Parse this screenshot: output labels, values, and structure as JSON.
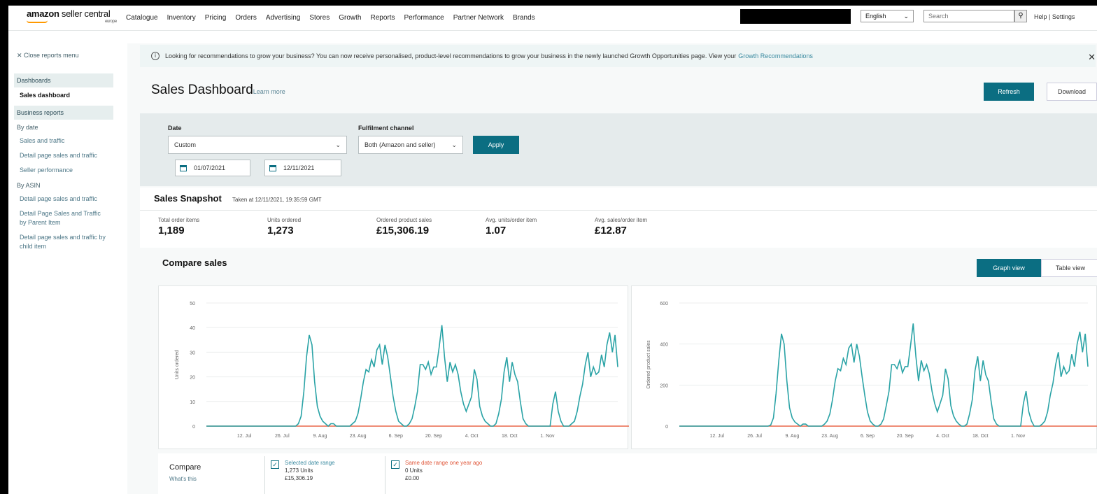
{
  "logo": {
    "brand": "amazon",
    "product": "seller central",
    "region": "europe"
  },
  "nav": [
    "Catalogue",
    "Inventory",
    "Pricing",
    "Orders",
    "Advertising",
    "Stores",
    "Growth",
    "Reports",
    "Performance",
    "Partner Network",
    "Brands"
  ],
  "language": {
    "selected": "English"
  },
  "search": {
    "placeholder": "Search"
  },
  "help_settings": "Help | Settings",
  "sidebar": {
    "close_label": "Close reports menu",
    "dashboards_header": "Dashboards",
    "active_item": "Sales dashboard",
    "business_header": "Business reports",
    "by_date_label": "By date",
    "by_date_items": [
      "Sales and traffic",
      "Detail page sales and traffic",
      "Seller performance"
    ],
    "by_asin_label": "By ASIN",
    "by_asin_items": [
      "Detail page sales and traffic",
      "Detail Page Sales and Traffic by Parent Item",
      "Detail page sales and traffic by child item"
    ]
  },
  "banner": {
    "text": "Looking for recommendations to grow your business? You can now receive personalised, product-level recommendations to grow your business in the newly launched Growth Opportunities page. View your",
    "link": "Growth Recommendations"
  },
  "page": {
    "title": "Sales Dashboard",
    "learn_more": "Learn more",
    "refresh_label": "Refresh",
    "download_label": "Download"
  },
  "filters": {
    "date_label": "Date",
    "date_value": "Custom",
    "start_date": "01/07/2021",
    "end_date": "12/11/2021",
    "channel_label": "Fulfilment channel",
    "channel_value": "Both (Amazon and seller)",
    "apply_label": "Apply"
  },
  "snapshot": {
    "title": "Sales Snapshot",
    "taken": "Taken at 12/11/2021, 19:35:59 GMT",
    "metrics": [
      {
        "label": "Total order items",
        "value": "1,189"
      },
      {
        "label": "Units ordered",
        "value": "1,273"
      },
      {
        "label": "Ordered product sales",
        "value": "£15,306.19"
      },
      {
        "label": "Avg. units/order item",
        "value": "1.07"
      },
      {
        "label": "Avg. sales/order item",
        "value": "£12.87"
      }
    ]
  },
  "compare": {
    "title": "Compare sales",
    "graph_view_label": "Graph view",
    "table_view_label": "Table view",
    "compare_label": "Compare",
    "whats_this": "What's this",
    "legend": [
      {
        "title": "Selected date range",
        "line1": "1,273 Units",
        "line2": "£15,306.19"
      },
      {
        "title": "Same date range one year ago",
        "line1": "0 Units",
        "line2": "£0.00"
      }
    ]
  },
  "colors": {
    "accent": "#0b6e82",
    "current_series": "#2aa3a6",
    "previous_series": "#e8674a"
  },
  "chart_data": [
    {
      "type": "line",
      "ylabel": "Units ordered",
      "ylim": [
        0,
        50
      ],
      "yticks": [
        0,
        10,
        20,
        30,
        40,
        50
      ],
      "xticks": [
        "12. Jul",
        "26. Jul",
        "9. Aug",
        "23. Aug",
        "6. Sep",
        "20. Sep",
        "4. Oct",
        "18. Oct",
        "1. Nov"
      ],
      "x_start_day": 0,
      "series": [
        {
          "values": [
            0,
            0,
            0,
            0,
            0,
            0,
            0,
            0,
            0,
            0,
            0,
            0,
            0,
            0,
            0,
            0,
            0,
            0,
            0,
            0,
            0,
            0,
            0,
            0,
            0,
            0,
            0,
            0,
            0,
            0,
            0,
            0,
            0,
            0,
            1,
            4,
            14,
            28,
            37,
            33,
            18,
            8,
            4,
            2,
            1,
            0,
            1,
            1,
            0,
            0,
            0,
            0,
            0,
            0,
            1,
            2,
            5,
            11,
            18,
            23,
            22,
            27,
            24,
            31,
            33,
            25,
            33,
            28,
            20,
            12,
            6,
            2,
            1,
            0,
            0,
            1,
            3,
            8,
            14,
            25,
            25,
            23,
            26,
            21,
            24,
            24,
            32,
            41,
            28,
            18,
            26,
            22,
            25,
            21,
            14,
            9,
            6,
            9,
            12,
            23,
            19,
            8,
            4,
            2,
            1,
            0,
            0,
            1,
            5,
            11,
            22,
            28,
            18,
            26,
            21,
            18,
            10,
            3,
            1,
            0,
            0,
            0,
            0,
            0,
            0,
            0,
            0,
            0,
            9,
            14,
            6,
            2,
            0,
            0,
            0,
            1,
            2,
            6,
            12,
            17,
            25,
            30,
            20,
            24,
            21,
            22,
            29,
            24,
            33,
            38,
            30,
            37,
            24
          ]
        },
        {
          "values": [
            0,
            0,
            0,
            0,
            0,
            0,
            0,
            0,
            0,
            0,
            0,
            0,
            0,
            0,
            0,
            0,
            0,
            0,
            0,
            0,
            0,
            0,
            0,
            0,
            0,
            0,
            0,
            0,
            0,
            0,
            0,
            0,
            0,
            0,
            0,
            0,
            0,
            0,
            0,
            0,
            0,
            0,
            0,
            0,
            0,
            0,
            0,
            0,
            0,
            0,
            0,
            0,
            0,
            0,
            0,
            0,
            0,
            0,
            0,
            0,
            0,
            0,
            0,
            0,
            0,
            0,
            0,
            0,
            0,
            0,
            0,
            0,
            0,
            0,
            0,
            0,
            0,
            0,
            0,
            0,
            0,
            0,
            0,
            0,
            0,
            0,
            0,
            0,
            0,
            0,
            0,
            0,
            0,
            0,
            0,
            0,
            0,
            0,
            0,
            0,
            0,
            0,
            0,
            0,
            0,
            0,
            0,
            0,
            0,
            0,
            0,
            0,
            0,
            0,
            0,
            0,
            0,
            0,
            0,
            0,
            0,
            0,
            0,
            0,
            0,
            0,
            0,
            0,
            0,
            0,
            0,
            0,
            0,
            0,
            0,
            0,
            0,
            0,
            0,
            0,
            0,
            0,
            0,
            0,
            0,
            0,
            0,
            0,
            0,
            0,
            0,
            0,
            0,
            0,
            0,
            0,
            0,
            0
          ]
        }
      ]
    },
    {
      "type": "line",
      "ylabel": "Ordered product sales",
      "ylim": [
        0,
        600
      ],
      "yticks": [
        0,
        200,
        400,
        600
      ],
      "yticklabels": [
        "0",
        "200",
        "400",
        "600"
      ],
      "xticks": [
        "12. Jul",
        "26. Jul",
        "9. Aug",
        "23. Aug",
        "6. Sep",
        "20. Sep",
        "4. Oct",
        "18. Oct",
        "1. Nov"
      ],
      "series": [
        {
          "values": [
            0,
            0,
            0,
            0,
            0,
            0,
            0,
            0,
            0,
            0,
            0,
            0,
            0,
            0,
            0,
            0,
            0,
            0,
            0,
            0,
            0,
            0,
            0,
            0,
            0,
            0,
            0,
            0,
            0,
            0,
            0,
            0,
            0,
            0,
            5,
            40,
            160,
            320,
            450,
            400,
            220,
            90,
            40,
            20,
            10,
            0,
            10,
            10,
            0,
            0,
            0,
            0,
            0,
            0,
            10,
            25,
            60,
            130,
            220,
            280,
            270,
            330,
            300,
            380,
            400,
            310,
            400,
            340,
            240,
            150,
            70,
            25,
            10,
            0,
            0,
            10,
            35,
            100,
            170,
            300,
            300,
            280,
            320,
            260,
            290,
            290,
            390,
            500,
            340,
            220,
            320,
            270,
            300,
            255,
            170,
            110,
            70,
            110,
            150,
            280,
            230,
            100,
            50,
            25,
            10,
            0,
            0,
            10,
            60,
            130,
            270,
            340,
            220,
            320,
            250,
            220,
            120,
            35,
            10,
            0,
            0,
            0,
            0,
            0,
            0,
            0,
            0,
            0,
            110,
            170,
            70,
            25,
            0,
            0,
            0,
            10,
            25,
            70,
            150,
            210,
            300,
            360,
            240,
            290,
            255,
            270,
            350,
            290,
            400,
            460,
            360,
            450,
            290
          ]
        },
        {
          "values": [
            0,
            0,
            0,
            0,
            0,
            0,
            0,
            0,
            0,
            0,
            0,
            0,
            0,
            0,
            0,
            0,
            0,
            0,
            0,
            0,
            0,
            0,
            0,
            0,
            0,
            0,
            0,
            0,
            0,
            0,
            0,
            0,
            0,
            0,
            0,
            0,
            0,
            0,
            0,
            0,
            0,
            0,
            0,
            0,
            0,
            0,
            0,
            0,
            0,
            0,
            0,
            0,
            0,
            0,
            0,
            0,
            0,
            0,
            0,
            0,
            0,
            0,
            0,
            0,
            0,
            0,
            0,
            0,
            0,
            0,
            0,
            0,
            0,
            0,
            0,
            0,
            0,
            0,
            0,
            0,
            0,
            0,
            0,
            0,
            0,
            0,
            0,
            0,
            0,
            0,
            0,
            0,
            0,
            0,
            0,
            0,
            0,
            0,
            0,
            0,
            0,
            0,
            0,
            0,
            0,
            0,
            0,
            0,
            0,
            0,
            0,
            0,
            0,
            0,
            0,
            0,
            0,
            0,
            0,
            0,
            0,
            0,
            0,
            0,
            0,
            0,
            0,
            0,
            0,
            0,
            0,
            0,
            0,
            0,
            0,
            0,
            0,
            0,
            0,
            0,
            0,
            0,
            0,
            0,
            0,
            0,
            0,
            0,
            0,
            0,
            0,
            0,
            0,
            0,
            0,
            0,
            0,
            0
          ]
        }
      ]
    }
  ]
}
